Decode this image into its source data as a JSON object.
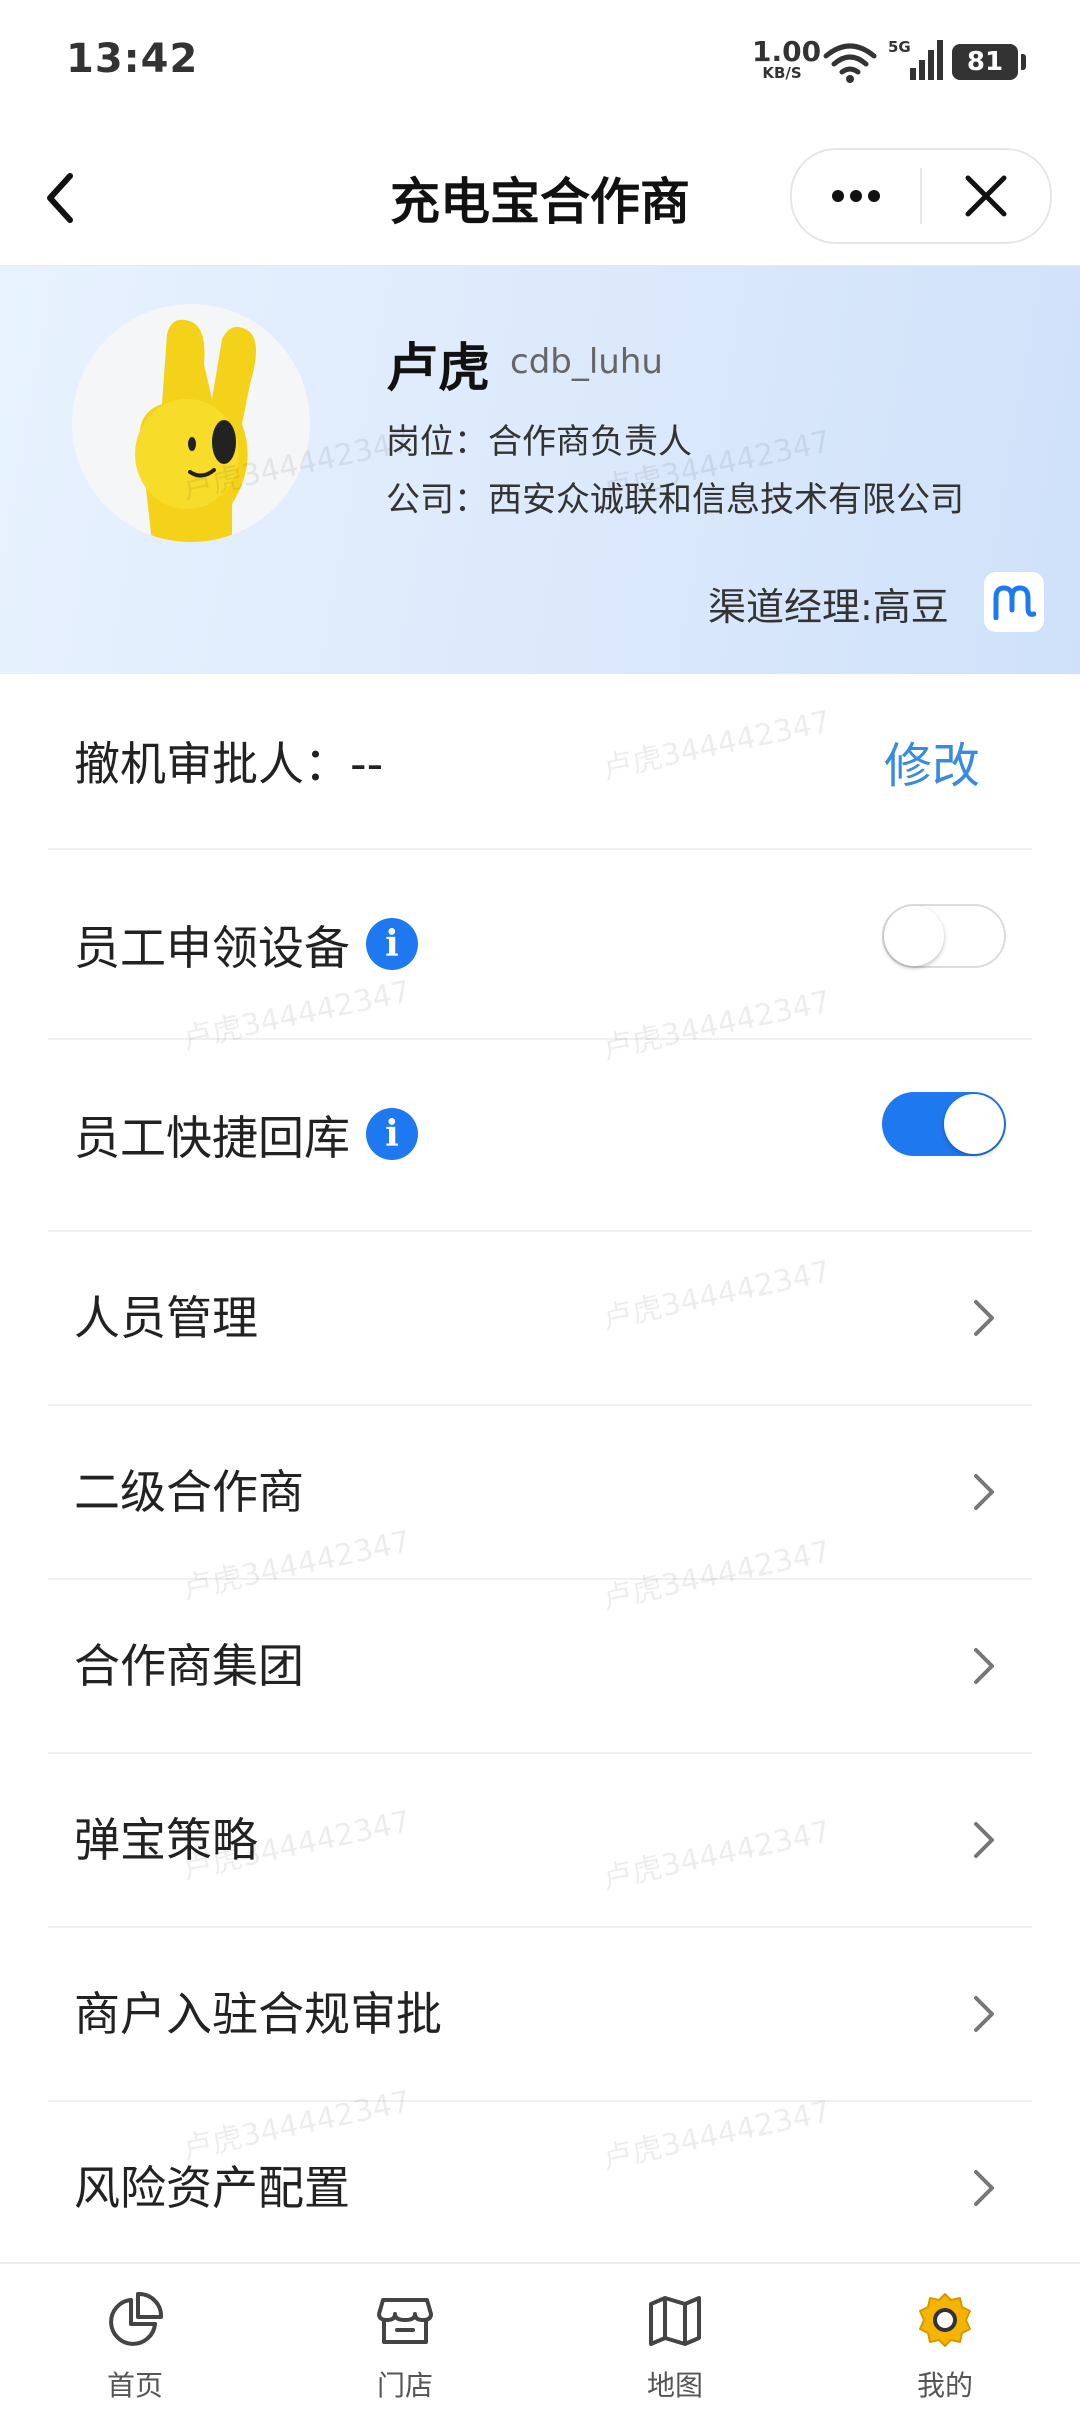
{
  "status_bar": {
    "time": "13:42",
    "net_speed_value": "1.00",
    "net_speed_unit": "KB/S",
    "network_type": "5G",
    "battery": "81"
  },
  "nav": {
    "title": "充电宝合作商",
    "back_icon": "chevron-left-icon",
    "more_icon": "more-dots-icon",
    "close_icon": "close-icon"
  },
  "profile": {
    "name": "卢虎",
    "user_id": "cdb_luhu",
    "position_label": "岗位：",
    "position_value": "合作商负责人",
    "company_label": "公司：",
    "company_value": "西安众诚联和信息技术有限公司",
    "manager_text": "渠道经理:高豆"
  },
  "list": {
    "revoke_approver_label": "撤机审批人：",
    "revoke_approver_value": "--",
    "edit_label": "修改",
    "items": [
      {
        "label": "员工申领设备",
        "info": true,
        "toggle": "off"
      },
      {
        "label": "员工快捷回库",
        "info": true,
        "toggle": "on"
      },
      {
        "label": "人员管理"
      },
      {
        "label": "二级合作商"
      },
      {
        "label": "合作商集团"
      },
      {
        "label": "弹宝策略"
      },
      {
        "label": "商户入驻合规审批"
      },
      {
        "label": "风险资产配置"
      }
    ]
  },
  "watermark": "卢虎344442347",
  "tabs": [
    {
      "label": "首页",
      "icon": "pie-chart-icon",
      "active": false
    },
    {
      "label": "门店",
      "icon": "store-icon",
      "active": false
    },
    {
      "label": "地图",
      "icon": "map-icon",
      "active": false
    },
    {
      "label": "我的",
      "icon": "gear-icon",
      "active": true
    }
  ],
  "colors": {
    "accent": "#1e78f0",
    "link": "#3a8be0",
    "active_tab": "#f5b400",
    "header_gradient_start": "#e8f2ff",
    "header_gradient_end": "#cfe1fa"
  }
}
